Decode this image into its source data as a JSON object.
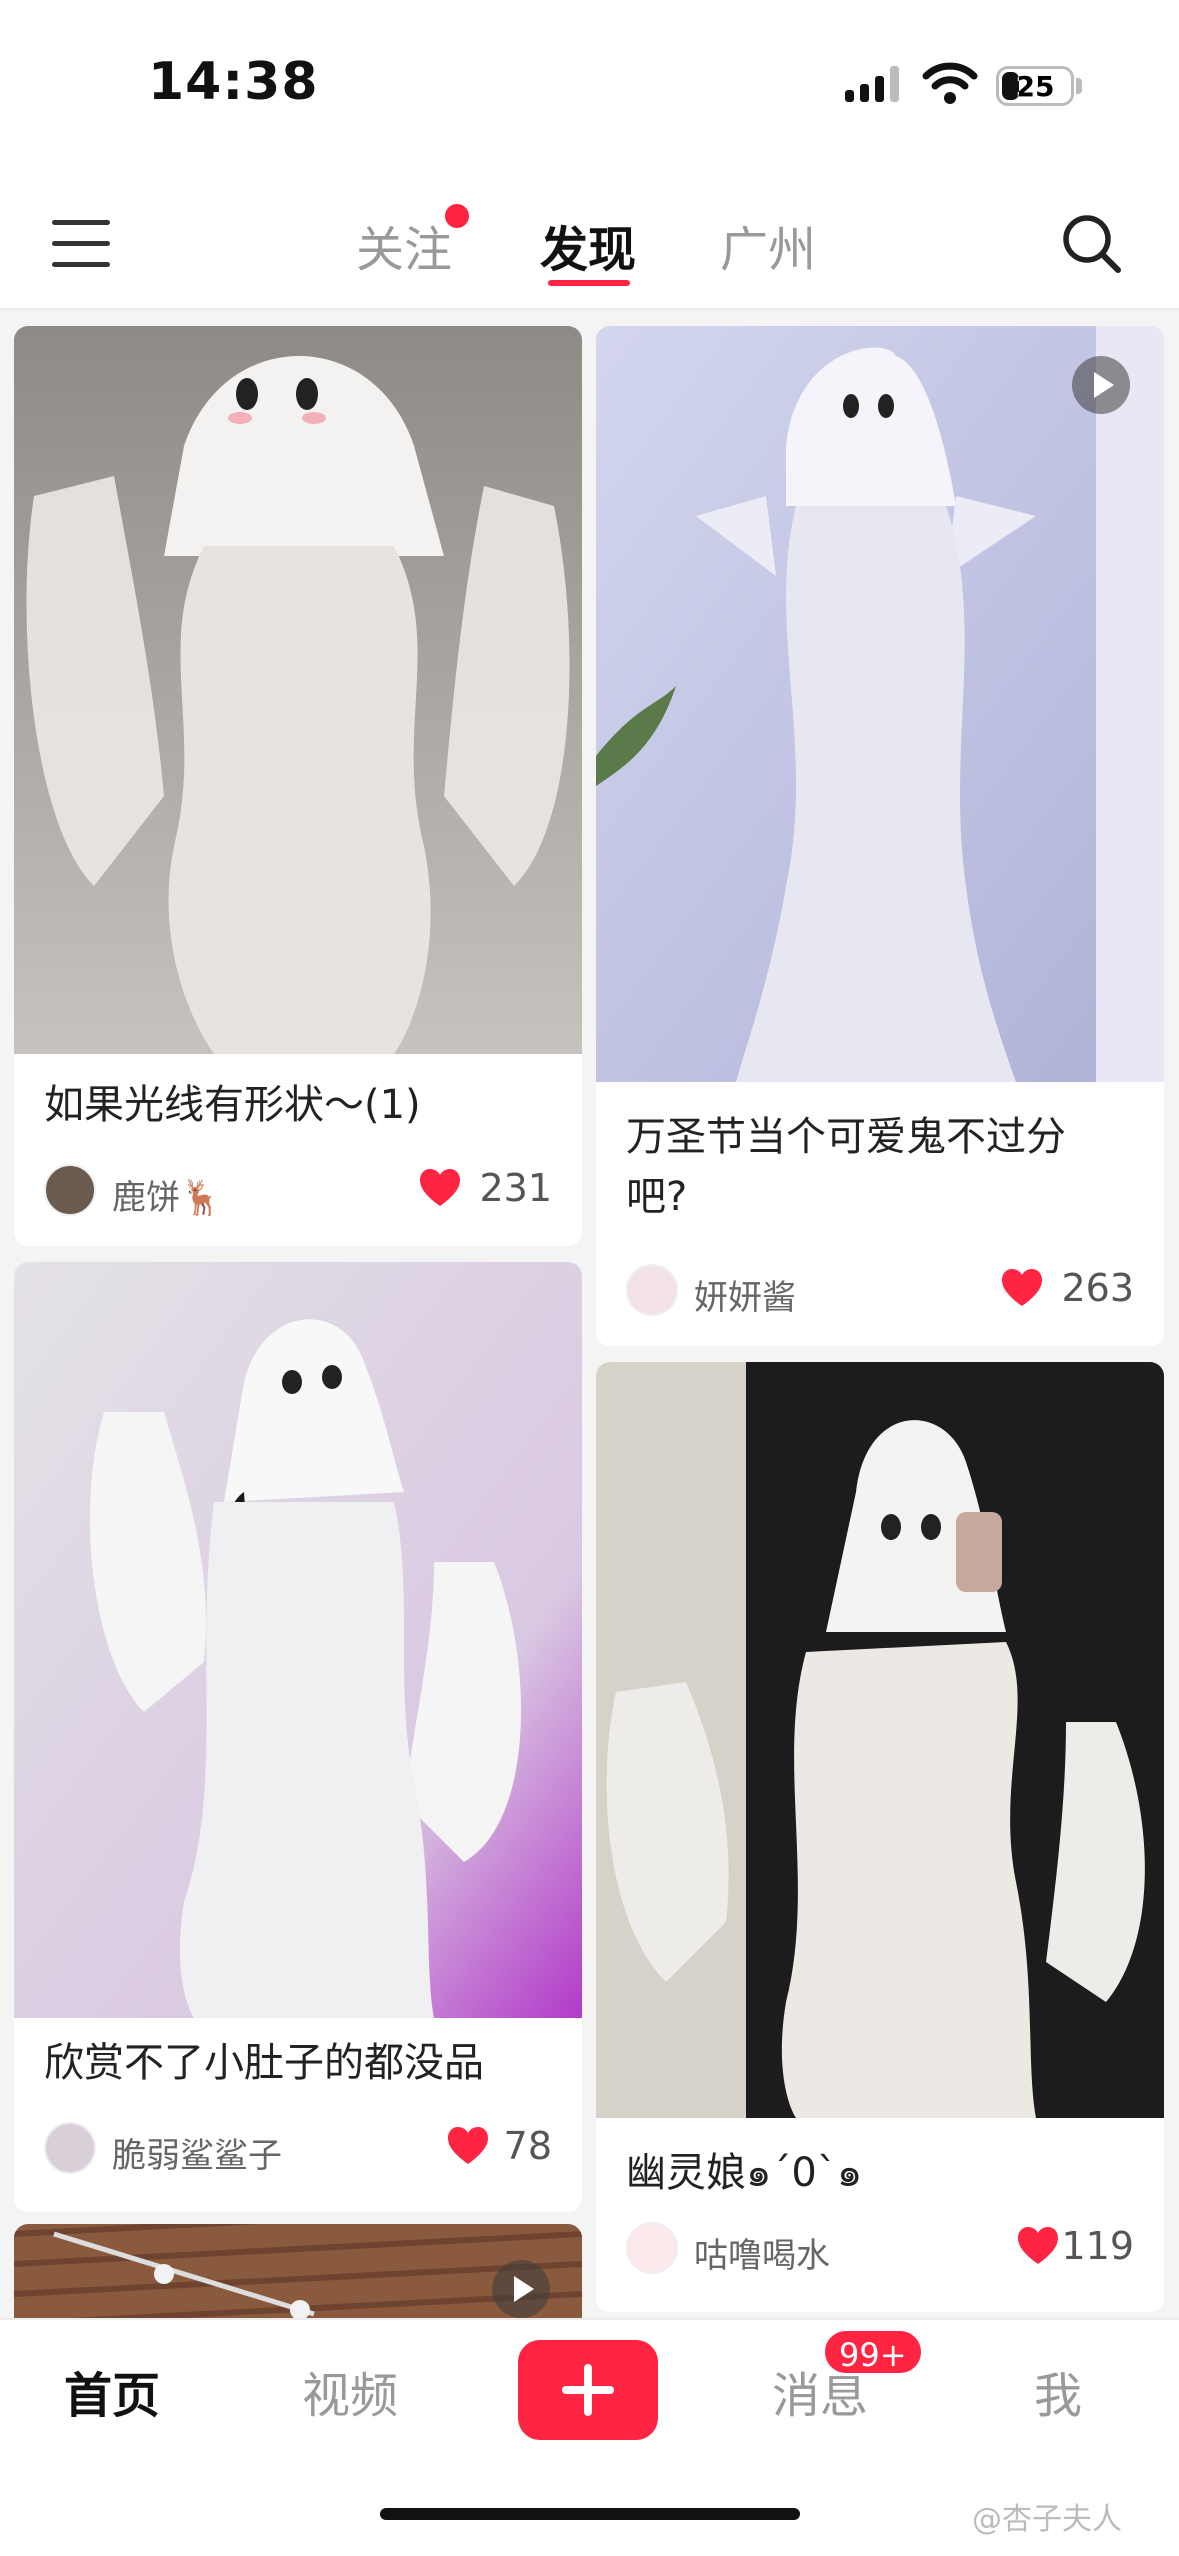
{
  "status_bar": {
    "time": "14:38",
    "battery": "25"
  },
  "top_nav": {
    "tabs": [
      {
        "label": "关注"
      },
      {
        "label": "发现"
      },
      {
        "label": "广州"
      }
    ]
  },
  "feed": {
    "cards": [
      {
        "title": "如果光线有形状～(1)",
        "author": "鹿饼🦌",
        "likes": "231"
      },
      {
        "title": "万圣节当个可爱鬼不过分吧?",
        "title_line1": "万圣节当个可爱鬼不过分",
        "title_line2": "吧?",
        "author": "妍妍酱",
        "likes": "263"
      },
      {
        "title": "欣赏不了小肚子的都没品",
        "author": "脆弱鲨鲨子",
        "likes": "78"
      },
      {
        "title": "幽灵娘๑´0`๑",
        "author": "咕噜喝水",
        "likes": "119"
      }
    ]
  },
  "bottom_nav": {
    "home": "首页",
    "video": "视频",
    "messages": "消息",
    "messages_badge": "99+",
    "me": "我"
  },
  "watermark": "@杏子夫人",
  "colors": {
    "accent": "#ff2442",
    "text": "#222222",
    "muted": "#999999"
  }
}
